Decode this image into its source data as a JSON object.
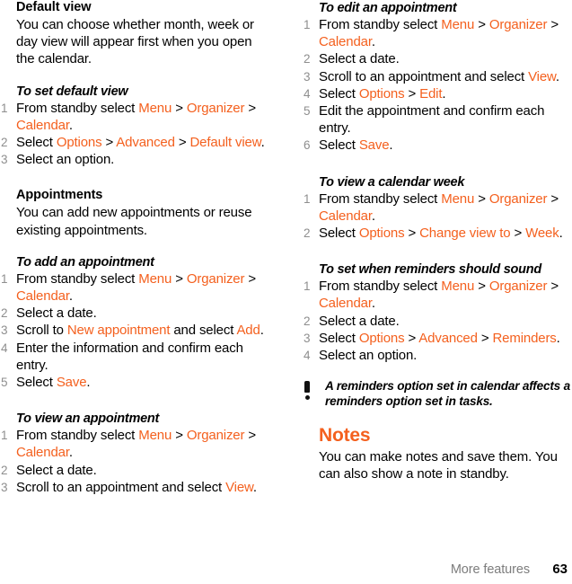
{
  "page": {
    "footer_label": "More features",
    "page_number": "63",
    "accent_color": "#F4601E",
    "number_color": "#8e8e8e",
    "text_color": "#000000"
  },
  "left_column": {
    "default_view": {
      "heading": "Default view",
      "body": "You can choose whether month, week or day view will appear first when you open the calendar."
    },
    "to_set_default_view": {
      "heading": "To set default view",
      "steps": [
        {
          "parts": [
            {
              "t": "From standby select ",
              "hl": false
            },
            {
              "t": "Menu",
              "hl": true
            },
            {
              "t": " > ",
              "hl": false
            },
            {
              "t": "Organizer",
              "hl": true
            },
            {
              "t": " > ",
              "hl": false
            },
            {
              "t": "Calendar",
              "hl": true
            },
            {
              "t": ".",
              "hl": false
            }
          ]
        },
        {
          "parts": [
            {
              "t": "Select ",
              "hl": false
            },
            {
              "t": "Options",
              "hl": true
            },
            {
              "t": " > ",
              "hl": false
            },
            {
              "t": "Advanced",
              "hl": true
            },
            {
              "t": " > ",
              "hl": false
            },
            {
              "t": "Default view",
              "hl": true
            },
            {
              "t": ".",
              "hl": false
            }
          ]
        },
        {
          "parts": [
            {
              "t": "Select an option.",
              "hl": false
            }
          ]
        }
      ]
    },
    "appointments": {
      "heading": "Appointments",
      "body": "You can add new appointments or reuse existing appointments."
    },
    "to_add_an_appointment": {
      "heading": "To add an appointment",
      "steps": [
        {
          "parts": [
            {
              "t": "From standby select ",
              "hl": false
            },
            {
              "t": "Menu",
              "hl": true
            },
            {
              "t": " > ",
              "hl": false
            },
            {
              "t": "Organizer",
              "hl": true
            },
            {
              "t": " > ",
              "hl": false
            },
            {
              "t": "Calendar",
              "hl": true
            },
            {
              "t": ".",
              "hl": false
            }
          ]
        },
        {
          "parts": [
            {
              "t": "Select a date.",
              "hl": false
            }
          ]
        },
        {
          "parts": [
            {
              "t": "Scroll to ",
              "hl": false
            },
            {
              "t": "New appointment",
              "hl": true
            },
            {
              "t": " and select ",
              "hl": false
            },
            {
              "t": "Add",
              "hl": true
            },
            {
              "t": ".",
              "hl": false
            }
          ]
        },
        {
          "parts": [
            {
              "t": "Enter the information and confirm each entry.",
              "hl": false
            }
          ]
        },
        {
          "parts": [
            {
              "t": "Select ",
              "hl": false
            },
            {
              "t": "Save",
              "hl": true
            },
            {
              "t": ".",
              "hl": false
            }
          ]
        }
      ]
    },
    "to_view_an_appointment": {
      "heading": "To view an appointment",
      "steps": [
        {
          "parts": [
            {
              "t": "From standby select ",
              "hl": false
            },
            {
              "t": "Menu",
              "hl": true
            },
            {
              "t": " > ",
              "hl": false
            },
            {
              "t": "Organizer",
              "hl": true
            },
            {
              "t": " > ",
              "hl": false
            },
            {
              "t": "Calendar",
              "hl": true
            },
            {
              "t": ".",
              "hl": false
            }
          ]
        },
        {
          "parts": [
            {
              "t": "Select a date.",
              "hl": false
            }
          ]
        },
        {
          "parts": [
            {
              "t": "Scroll to an appointment and select ",
              "hl": false
            },
            {
              "t": "View",
              "hl": true
            },
            {
              "t": ".",
              "hl": false
            }
          ]
        }
      ]
    }
  },
  "right_column": {
    "to_edit_an_appointment": {
      "heading": "To edit an appointment",
      "steps": [
        {
          "parts": [
            {
              "t": "From standby select ",
              "hl": false
            },
            {
              "t": "Menu",
              "hl": true
            },
            {
              "t": " > ",
              "hl": false
            },
            {
              "t": "Organizer",
              "hl": true
            },
            {
              "t": " > ",
              "hl": false
            },
            {
              "t": "Calendar",
              "hl": true
            },
            {
              "t": ".",
              "hl": false
            }
          ]
        },
        {
          "parts": [
            {
              "t": "Select a date.",
              "hl": false
            }
          ]
        },
        {
          "parts": [
            {
              "t": "Scroll to an appointment and select ",
              "hl": false
            },
            {
              "t": "View",
              "hl": true
            },
            {
              "t": ".",
              "hl": false
            }
          ]
        },
        {
          "parts": [
            {
              "t": "Select ",
              "hl": false
            },
            {
              "t": "Options",
              "hl": true
            },
            {
              "t": " > ",
              "hl": false
            },
            {
              "t": "Edit",
              "hl": true
            },
            {
              "t": ".",
              "hl": false
            }
          ]
        },
        {
          "parts": [
            {
              "t": "Edit the appointment and confirm each entry.",
              "hl": false
            }
          ]
        },
        {
          "parts": [
            {
              "t": "Select ",
              "hl": false
            },
            {
              "t": "Save",
              "hl": true
            },
            {
              "t": ".",
              "hl": false
            }
          ]
        }
      ]
    },
    "to_view_a_calendar_week": {
      "heading": "To view a calendar week",
      "steps": [
        {
          "parts": [
            {
              "t": "From standby select ",
              "hl": false
            },
            {
              "t": "Menu",
              "hl": true
            },
            {
              "t": " > ",
              "hl": false
            },
            {
              "t": "Organizer",
              "hl": true
            },
            {
              "t": " > ",
              "hl": false
            },
            {
              "t": "Calendar",
              "hl": true
            },
            {
              "t": ".",
              "hl": false
            }
          ]
        },
        {
          "parts": [
            {
              "t": "Select ",
              "hl": false
            },
            {
              "t": "Options",
              "hl": true
            },
            {
              "t": " > ",
              "hl": false
            },
            {
              "t": "Change view to",
              "hl": true
            },
            {
              "t": " > ",
              "hl": false
            },
            {
              "t": "Week",
              "hl": true
            },
            {
              "t": ".",
              "hl": false
            }
          ]
        }
      ]
    },
    "to_set_when_reminders_should_sound": {
      "heading": "To set when reminders should sound",
      "steps": [
        {
          "parts": [
            {
              "t": "From standby select ",
              "hl": false
            },
            {
              "t": "Menu",
              "hl": true
            },
            {
              "t": " > ",
              "hl": false
            },
            {
              "t": "Organizer",
              "hl": true
            },
            {
              "t": " > ",
              "hl": false
            },
            {
              "t": "Calendar",
              "hl": true
            },
            {
              "t": ".",
              "hl": false
            }
          ]
        },
        {
          "parts": [
            {
              "t": "Select a date.",
              "hl": false
            }
          ]
        },
        {
          "parts": [
            {
              "t": "Select ",
              "hl": false
            },
            {
              "t": "Options",
              "hl": true
            },
            {
              "t": " > ",
              "hl": false
            },
            {
              "t": "Advanced",
              "hl": true
            },
            {
              "t": " > ",
              "hl": false
            },
            {
              "t": "Reminders",
              "hl": true
            },
            {
              "t": ".",
              "hl": false
            }
          ]
        },
        {
          "parts": [
            {
              "t": "Select an option.",
              "hl": false
            }
          ]
        }
      ]
    },
    "note": {
      "icon": "exclamation-icon",
      "text": "A reminders option set in calendar affects a reminders option set in tasks."
    },
    "notes_section": {
      "heading": "Notes",
      "body": "You can make notes and save them. You can also show a note in standby."
    }
  }
}
